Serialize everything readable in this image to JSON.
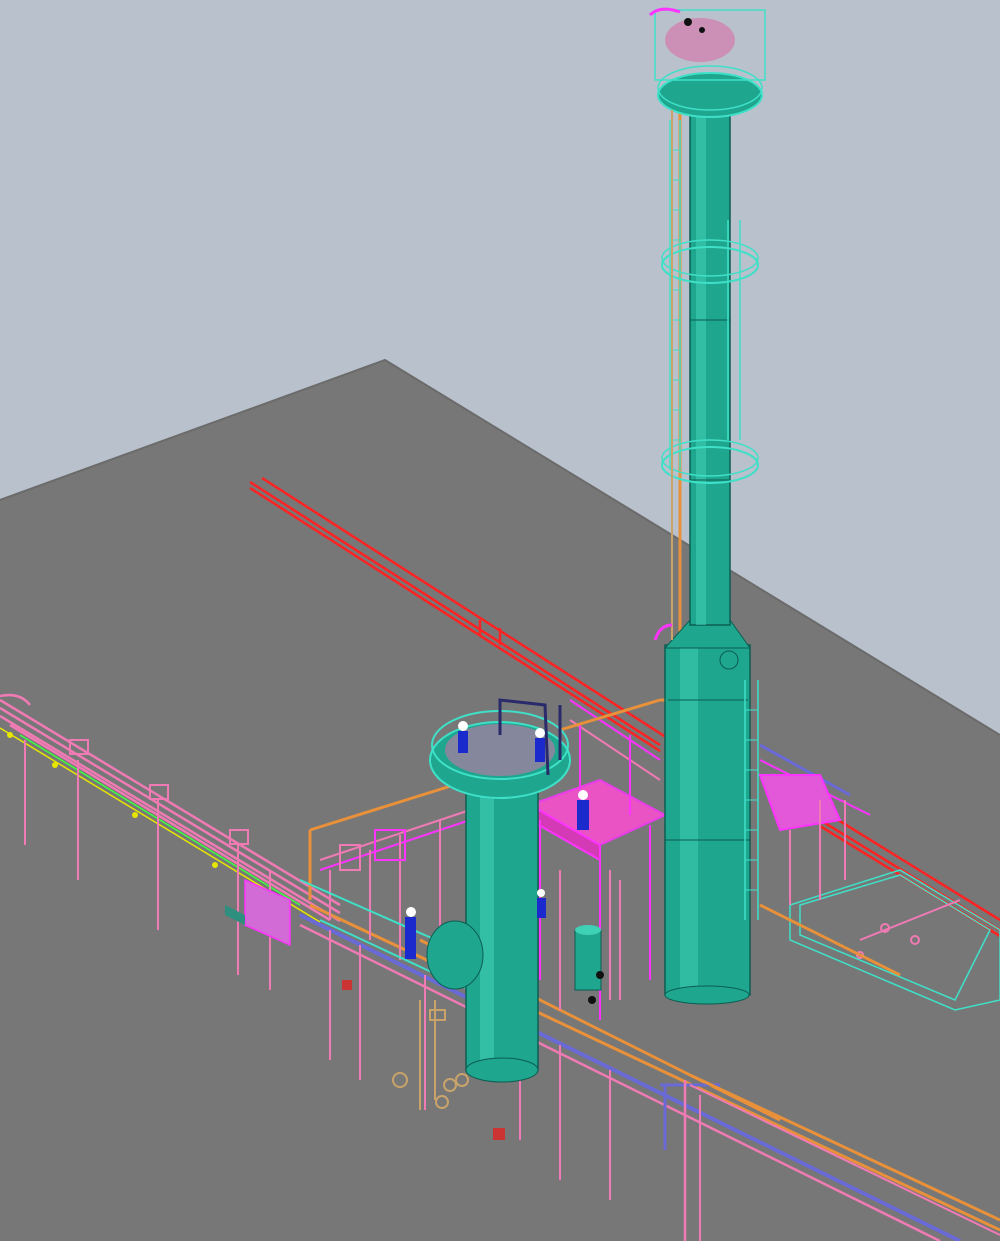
{
  "scene": {
    "kind": "3d-plant-model-viewport",
    "colors": {
      "sky": "#b9c1cc",
      "ground": "#777777",
      "ground_dark": "#6b6b6b",
      "vessel_fill": "#1fa68f",
      "vessel_stroke": "#0b5e52",
      "vessel_highlight": "#3fd1b6",
      "outline_cyan": "#3fe0c8",
      "pipe_red": "#ff2222",
      "pipe_pink": "#f07ab4",
      "pipe_magenta": "#ff33ff",
      "pipe_orange": "#e8913a",
      "pipe_blue": "#6a6ad6",
      "pipe_yellow": "#e6e600",
      "pipe_green": "#40ff40",
      "pipe_tan": "#c9a36a",
      "worker_blue": "#1a2acc",
      "worker_white": "#ffffff"
    },
    "icons": [
      "worker-figure-icon",
      "valve-icon"
    ]
  }
}
